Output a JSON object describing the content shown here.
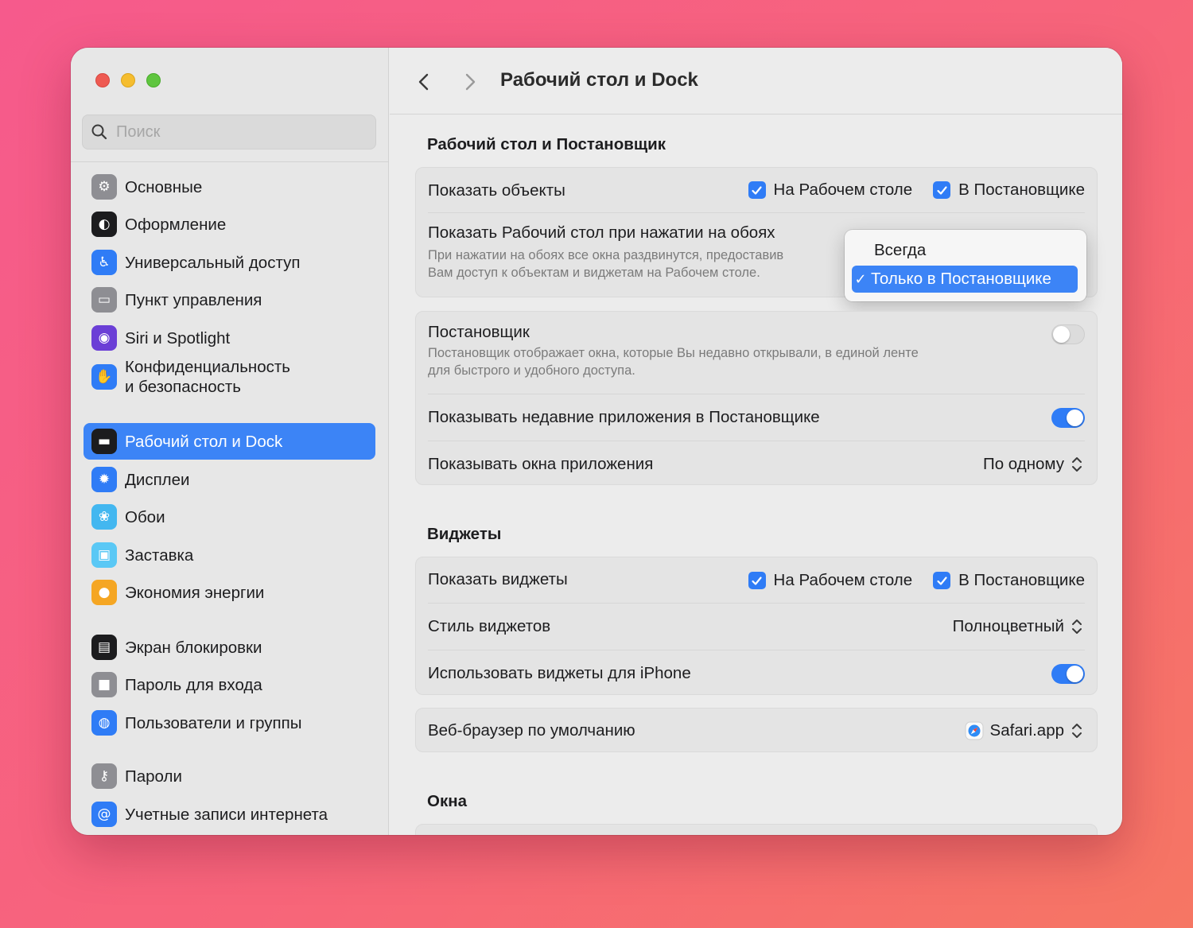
{
  "sidebar": {
    "search": {
      "placeholder": "Поиск",
      "value": ""
    },
    "items": [
      {
        "label": "Основные",
        "icon": "gear-icon",
        "color": "#8e8e93"
      },
      {
        "label": "Оформление",
        "icon": "appearance-icon",
        "color": "#1c1c1e"
      },
      {
        "label": "Универсальный доступ",
        "icon": "accessibility-icon",
        "color": "#2f7cf6"
      },
      {
        "label": "Пункт управления",
        "icon": "control-center-icon",
        "color": "#8e8e93"
      },
      {
        "label": "Siri и Spotlight",
        "icon": "siri-icon",
        "color": "#6b3fd6"
      },
      {
        "label": "Конфиденциальность\nи безопасность",
        "icon": "hand-icon",
        "color": "#2f7cf6"
      },
      {
        "label": "Рабочий стол и Dock",
        "icon": "dock-icon",
        "color": "#1c1c1e",
        "active": true
      },
      {
        "label": "Дисплеи",
        "icon": "sun-icon",
        "color": "#2f7cf6"
      },
      {
        "label": "Обои",
        "icon": "flower-icon",
        "color": "#43b7f0"
      },
      {
        "label": "Заставка",
        "icon": "screensaver-icon",
        "color": "#5ac8f5"
      },
      {
        "label": "Экономия энергии",
        "icon": "bulb-icon",
        "color": "#f5a623"
      },
      {
        "label": "Экран блокировки",
        "icon": "lock-screen-icon",
        "color": "#1c1c1e"
      },
      {
        "label": "Пароль для входа",
        "icon": "lock-icon",
        "color": "#8e8e93"
      },
      {
        "label": "Пользователи и группы",
        "icon": "users-icon",
        "color": "#2f7cf6"
      },
      {
        "label": "Пароли",
        "icon": "key-icon",
        "color": "#8e8e93"
      },
      {
        "label": "Учетные записи интернета",
        "icon": "at-icon",
        "color": "#2f7cf6"
      }
    ]
  },
  "header": {
    "title": "Рабочий стол и Dock"
  },
  "sections": {
    "desktop": {
      "title": "Рабочий стол и Постановщик",
      "show_items": {
        "label": "Показать объекты",
        "opt1": {
          "label": "На Рабочем столе",
          "checked": true
        },
        "opt2": {
          "label": "В Постановщике",
          "checked": true
        }
      },
      "click_wallpaper": {
        "label": "Показать Рабочий стол при нажатии на обоях",
        "desc1": "При нажатии на обоях все окна раздвинутся, предоставив",
        "desc2": "Вам доступ к объектам и виджетам на Рабочем столе."
      },
      "menu": {
        "options": [
          "Всегда",
          "Только в Постановщике"
        ],
        "selected": "Только в Постановщике",
        "check": "✓"
      }
    },
    "stage": {
      "stage_manager": {
        "label": "Постановщик",
        "desc1": "Постановщик отображает окна, которые Вы недавно открывали, в единой ленте",
        "desc2": "для быстрого и удобного доступа.",
        "on": false
      },
      "recent_apps": {
        "label": "Показывать недавние приложения в Постановщике",
        "on": true
      },
      "app_windows": {
        "label": "Показывать окна приложения",
        "value": "По одному"
      }
    },
    "widgets": {
      "title": "Виджеты",
      "show_widgets": {
        "label": "Показать виджеты",
        "opt1": {
          "label": "На Рабочем столе",
          "checked": true
        },
        "opt2": {
          "label": "В Постановщике",
          "checked": true
        }
      },
      "style": {
        "label": "Стиль виджетов",
        "value": "Полноцветный"
      },
      "iphone": {
        "label": "Использовать виджеты для iPhone",
        "on": true
      }
    },
    "browser": {
      "label": "Веб-браузер по умолчанию",
      "value": "Safari.app"
    },
    "windows": {
      "title": "Окна"
    }
  },
  "colors": {
    "accent": "#3c84f6",
    "checkbox": "#2f7cf6",
    "background": "#f65a8c"
  }
}
